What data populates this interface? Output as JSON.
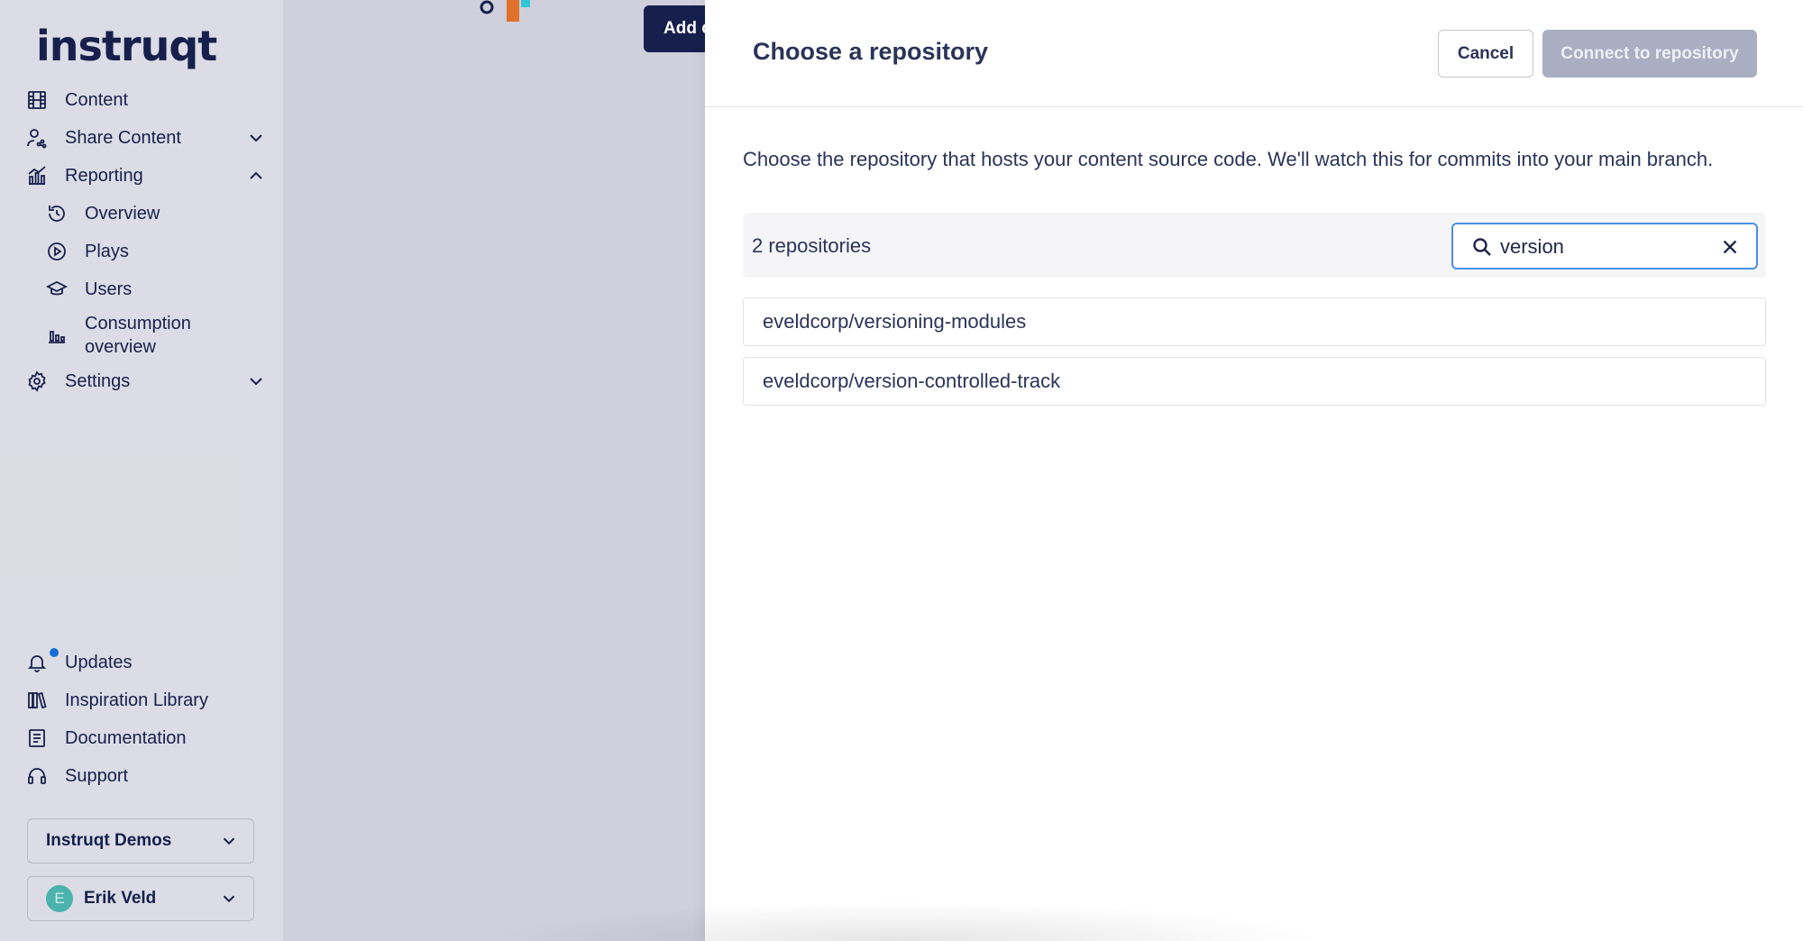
{
  "brand": {
    "logo_text": "instruqt"
  },
  "sidebar": {
    "items": [
      {
        "label": "Content",
        "icon": "film-icon"
      },
      {
        "label": "Share Content",
        "icon": "share-user-icon",
        "expanded": false
      },
      {
        "label": "Reporting",
        "icon": "chart-icon",
        "expanded": true
      },
      {
        "label": "Settings",
        "icon": "gear-icon",
        "expanded": false
      }
    ],
    "reporting_sub": [
      {
        "label": "Overview",
        "icon": "history-icon"
      },
      {
        "label": "Plays",
        "icon": "play-circle-icon"
      },
      {
        "label": "Users",
        "icon": "graduation-cap-icon"
      },
      {
        "label_line1": "Consumption",
        "label_line2": "overview",
        "icon": "bar-chart-icon"
      }
    ],
    "bottom_items": [
      {
        "label": "Updates",
        "icon": "bell-icon",
        "has_notification": true
      },
      {
        "label": "Inspiration Library",
        "icon": "library-icon"
      },
      {
        "label": "Documentation",
        "icon": "document-icon"
      },
      {
        "label": "Support",
        "icon": "headset-icon"
      }
    ],
    "org_select": "Instruqt Demos",
    "user": {
      "initial": "E",
      "name": "Erik Veld"
    }
  },
  "background": {
    "add_button_label": "Add c"
  },
  "drawer": {
    "title": "Choose a repository",
    "cancel_label": "Cancel",
    "connect_label": "Connect to repository",
    "description": "Choose the repository that hosts your content source code. We'll watch this for commits into your main branch.",
    "repo_count": "2 repositories",
    "search": {
      "value": "version",
      "placeholder": ""
    },
    "repositories": [
      "eveldcorp/versioning-modules",
      "eveldcorp/version-controlled-track"
    ]
  },
  "colors": {
    "accent": "#4b8fe3",
    "brand_dark": "#17204d",
    "disabled_button": "#a9aec2",
    "notification": "#1875e0"
  }
}
